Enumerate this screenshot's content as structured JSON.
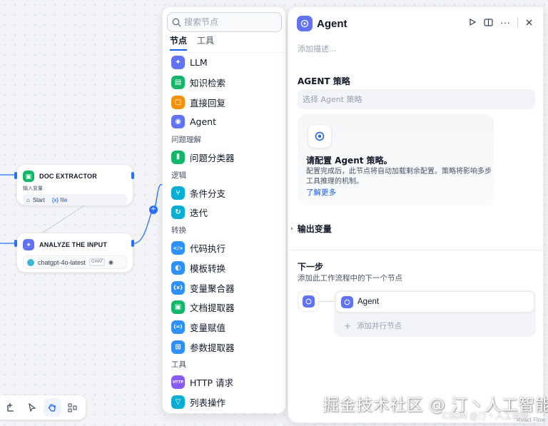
{
  "canvas": {
    "doc_extractor": {
      "title": "DOC EXTRACTOR",
      "sub_label": "输入变量",
      "chip_node": "Start",
      "chip_var": "{x} file",
      "color": "#12b76a"
    },
    "analyze": {
      "title": "ANALYZE THE INPUT",
      "model": "chatgpt-4o-latest",
      "model_tag": "CHAT",
      "color": "#6172f3"
    }
  },
  "toolbar": {
    "items": [
      "add-node",
      "pointer",
      "hand",
      "layout"
    ],
    "active": "hand"
  },
  "selector": {
    "search_placeholder": "搜索节点",
    "tabs": [
      "节点",
      "工具"
    ],
    "items": [
      {
        "label": "LLM",
        "color": "#6172f3",
        "glyph": "✦"
      },
      {
        "label": "知识检索",
        "color": "#12b76a",
        "glyph": "▤"
      },
      {
        "label": "直接回复",
        "color": "#f79009",
        "glyph": "▢"
      },
      {
        "label": "Agent",
        "color": "#6172f3",
        "glyph": "◉"
      }
    ],
    "group_qa": "问题理解",
    "items_qa": [
      {
        "label": "问题分类器",
        "color": "#12b76a",
        "glyph": "⫴"
      }
    ],
    "group_logic": "逻辑",
    "items_logic": [
      {
        "label": "条件分支",
        "color": "#06aed4",
        "glyph": "⑂"
      },
      {
        "label": "迭代",
        "color": "#06aed4",
        "glyph": "↻"
      }
    ],
    "group_transform": "转换",
    "items_transform": [
      {
        "label": "代码执行",
        "color": "#2e90fa",
        "glyph": "</>"
      },
      {
        "label": "模板转换",
        "color": "#2e90fa",
        "glyph": "◐"
      },
      {
        "label": "变量聚合器",
        "color": "#2e90fa",
        "glyph": "{x}"
      },
      {
        "label": "文档提取器",
        "color": "#12b76a",
        "glyph": "▣"
      },
      {
        "label": "变量赋值",
        "color": "#2e90fa",
        "glyph": "(=)"
      },
      {
        "label": "参数提取器",
        "color": "#2e90fa",
        "glyph": "⊞"
      }
    ],
    "group_tools": "工具",
    "items_tools": [
      {
        "label": "HTTP 请求",
        "color": "#875bf7",
        "glyph": "HTTP"
      },
      {
        "label": "列表操作",
        "color": "#06aed4",
        "glyph": "▽"
      }
    ]
  },
  "panel": {
    "title": "Agent",
    "description_placeholder": "添加描述...",
    "strategy_label": "AGENT 策略",
    "strategy_placeholder": "选择 Agent 策略",
    "card_title": "请配置 Agent 策略。",
    "card_desc": "配置完成后，此节点将自动加载剩余配置。策略将影响多步工具推理的机制。",
    "card_link": "了解更多",
    "output_label": "输出变量",
    "next_title": "下一步",
    "next_desc": "添加此工作流程中的下一个节点",
    "next_node": "Agent",
    "add_parallel": "添加并行节点"
  },
  "watermark": {
    "main": "掘金技术社区 @ 汀丶人工智能",
    "sub": "CSDN @汀丶人工智能"
  },
  "corner_text": "React Flow"
}
